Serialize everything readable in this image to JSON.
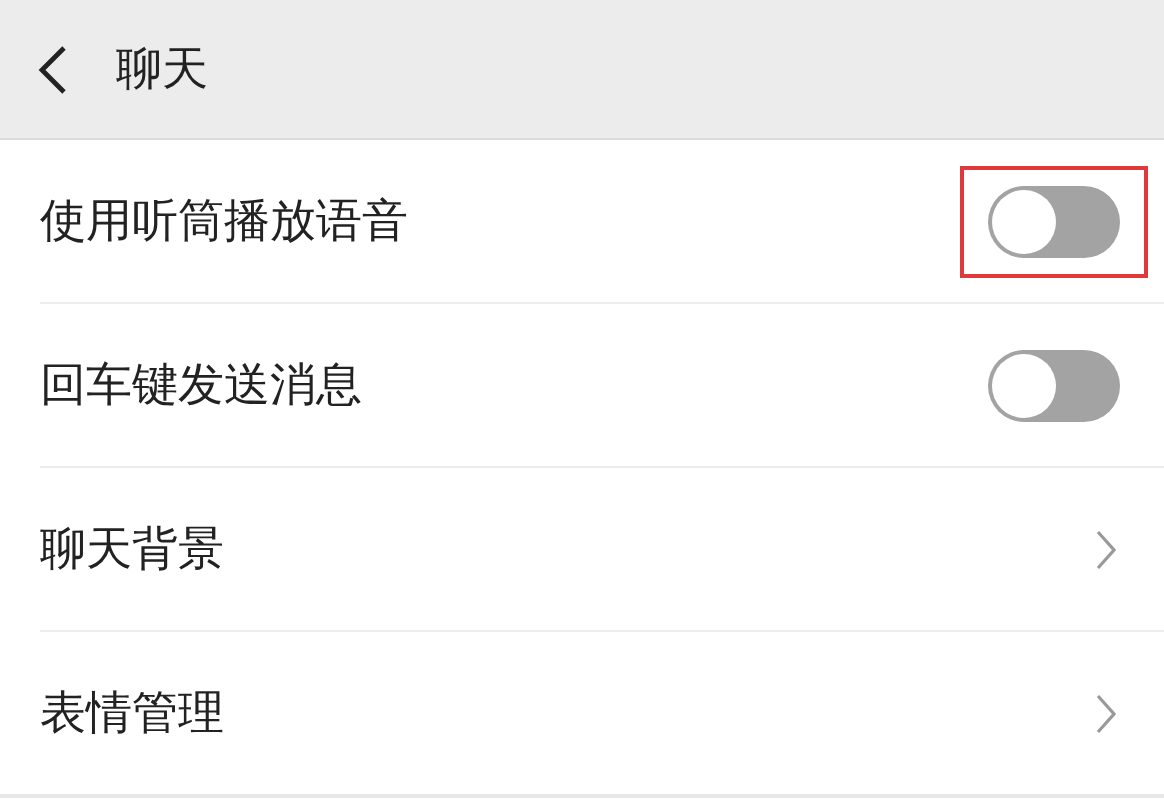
{
  "header": {
    "title": "聊天"
  },
  "rows": [
    {
      "kind": "switch",
      "label": "使用听筒播放语音",
      "on": false,
      "highlighted": true
    },
    {
      "kind": "switch",
      "label": "回车键发送消息",
      "on": false,
      "highlighted": false
    },
    {
      "kind": "link",
      "label": "聊天背景"
    },
    {
      "kind": "link",
      "label": "表情管理"
    }
  ]
}
